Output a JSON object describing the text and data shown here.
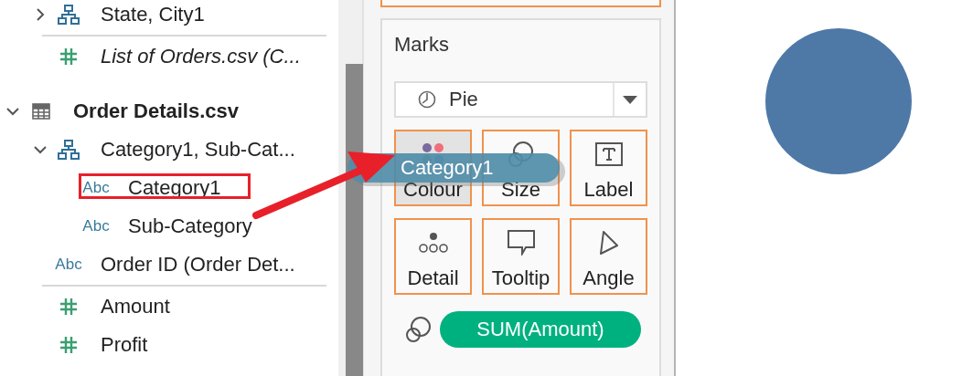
{
  "sidebar": {
    "items": [
      {
        "kind": "hierarchy",
        "label": "State, City1",
        "expanded": false
      },
      {
        "kind": "linked",
        "label": "List of Orders.csv (C..."
      }
    ],
    "tables": [
      {
        "label": "Order Details.csv",
        "expanded": true,
        "children": [
          {
            "kind": "hierarchy",
            "label": "Category1, Sub-Cat...",
            "expanded": true,
            "children": [
              {
                "kind": "dimension",
                "icon_text": "Abc",
                "label": "Category1"
              },
              {
                "kind": "dimension",
                "icon_text": "Abc",
                "label": "Sub-Category"
              }
            ]
          },
          {
            "kind": "dimension",
            "icon_text": "Abc",
            "label": "Order ID (Order Det..."
          },
          {
            "kind": "measure",
            "label": "Amount"
          },
          {
            "kind": "measure",
            "label": "Profit"
          }
        ]
      }
    ]
  },
  "marks": {
    "title": "Marks",
    "mark_type": {
      "kind": "pie",
      "label": "Pie"
    },
    "cards": [
      {
        "kind": "colour",
        "label": "Colour",
        "highlighted": true
      },
      {
        "kind": "size",
        "label": "Size",
        "highlighted": false
      },
      {
        "kind": "label",
        "label": "Label",
        "highlighted": false
      },
      {
        "kind": "detail",
        "label": "Detail",
        "highlighted": false
      },
      {
        "kind": "tooltip",
        "label": "Tooltip",
        "highlighted": false
      },
      {
        "kind": "angle",
        "label": "Angle",
        "highlighted": false
      }
    ],
    "fields": [
      {
        "kind": "size",
        "label": "SUM(Amount)"
      }
    ]
  },
  "drag_pill": {
    "label": "Category1"
  }
}
